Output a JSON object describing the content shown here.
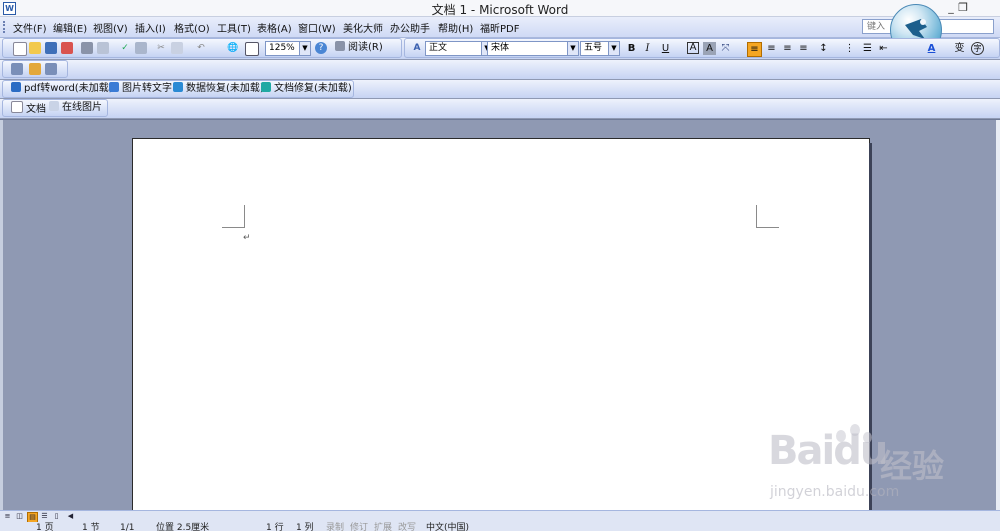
{
  "window": {
    "title": "文档 1 - Microsoft Word",
    "app_icon_glyph": "W",
    "minimize_glyph": "_",
    "restore_glyph": "❐"
  },
  "menu": {
    "items": [
      "文件(F)",
      "编辑(E)",
      "视图(V)",
      "插入(I)",
      "格式(O)",
      "工具(T)",
      "表格(A)",
      "窗口(W)",
      "美化大师",
      "办公助手",
      "帮助(H)",
      "福昕PDF"
    ],
    "help_search_placeholder": "键入"
  },
  "standard_toolbar": {
    "zoom": "125%",
    "read_label": "阅读(R)",
    "icons": [
      "new-icon",
      "open-icon",
      "save-icon",
      "permission-icon",
      "print-icon",
      "print-preview-icon",
      "spelling-icon",
      "research-icon",
      "cut-icon",
      "copy-icon",
      "undo-icon",
      "hyperlink-icon",
      "table-icon",
      "help-icon"
    ]
  },
  "formatting_toolbar": {
    "style": "正文",
    "font": "宋体",
    "size": "五号",
    "bold": "B",
    "italic": "I",
    "underline": "U",
    "char_border": "A",
    "char_shading": "A",
    "font_color": "A",
    "phonetic": "变"
  },
  "plugin_toolbar": {
    "buttons": [
      {
        "label": "pdf转word(未加载)",
        "color": "#2b6cc4"
      },
      {
        "label": "图片转文字",
        "color": "#3a7bd5"
      },
      {
        "label": "数据恢复(未加载)",
        "color": "#2a8ad4"
      },
      {
        "label": "文档修复(未加载)",
        "color": "#1fa9a3"
      }
    ]
  },
  "doc_toolbar": {
    "buttons": [
      {
        "label": "文档"
      },
      {
        "label": "在线图片"
      }
    ]
  },
  "document": {
    "paragraph_mark": "↵"
  },
  "status_bar": {
    "page": "1 页",
    "section": "1 节",
    "page_of": "1/1",
    "position": "位置 2.5厘米",
    "line": "1 行",
    "column": "1 列",
    "rec": "录制",
    "trk": "修订",
    "ext": "扩展",
    "ovr": "改写",
    "language": "中文(中国)"
  },
  "watermark": {
    "brand": "Baidu",
    "brand_cn": "经验",
    "url": "jingyen.baidu.com"
  }
}
